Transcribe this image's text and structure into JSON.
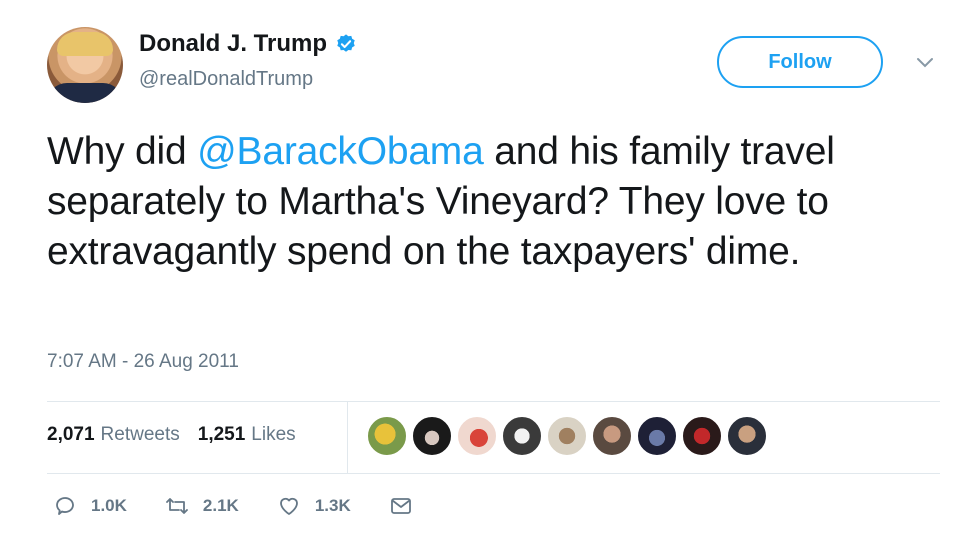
{
  "author": {
    "name": "Donald J. Trump",
    "handle": "@realDonaldTrump",
    "verified": true
  },
  "follow_label": "Follow",
  "tweet": {
    "prefix": "Why did ",
    "mention": "@BarackObama",
    "suffix": " and his family travel separately to Martha's Vineyard? They love to extravagantly spend on the taxpayers' dime.",
    "timestamp": "7:07 AM - 26 Aug 2011"
  },
  "stats": {
    "retweets_count": "2,071",
    "retweets_label": "Retweets",
    "likes_count": "1,251",
    "likes_label": "Likes"
  },
  "actions": {
    "reply_count": "1.0K",
    "retweet_count": "2.1K",
    "like_count": "1.3K"
  },
  "colors": {
    "accent": "#1da1f2",
    "muted": "#657786",
    "text": "#14171a",
    "divider": "#e1e8ed"
  },
  "icons": [
    "verified-badge-icon",
    "chevron-down-icon",
    "reply-icon",
    "retweet-icon",
    "heart-icon",
    "message-icon"
  ]
}
